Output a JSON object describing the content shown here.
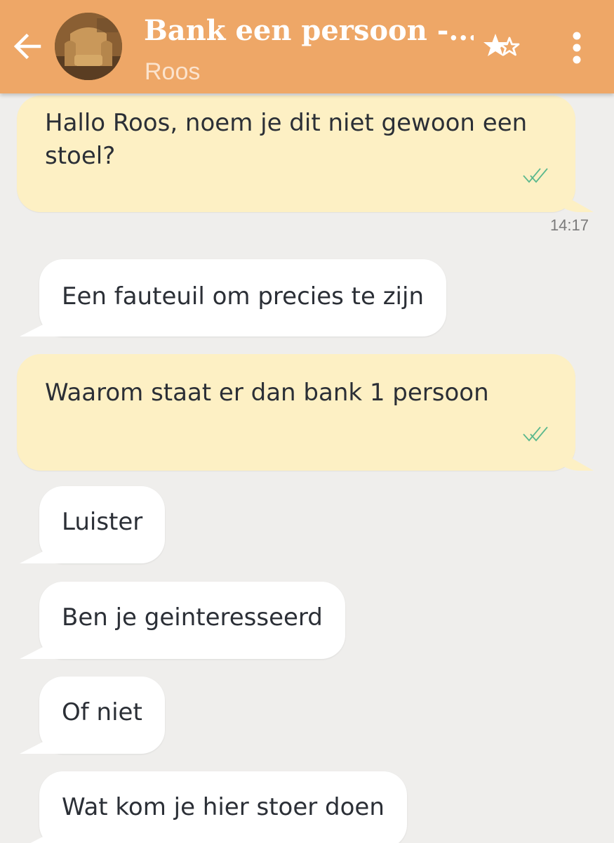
{
  "header": {
    "title": "Bank een persoon -...",
    "subtitle": "Roos",
    "back_icon": "arrow-left-icon",
    "favorite_icon": "star-add-icon",
    "more_icon": "more-vert-icon",
    "avatar_icon": "armchair-photo"
  },
  "colors": {
    "header": "#eea767",
    "background": "#efeeec",
    "outgoing_bubble": "#fdf0c4",
    "incoming_bubble": "#ffffff",
    "check": "#5bb88d"
  },
  "messages": [
    {
      "direction": "out",
      "text": "Hallo Roos,  noem je dit niet gewoon een stoel?",
      "status": "read",
      "time": "14:17"
    },
    {
      "direction": "in",
      "text": "Een fauteuil om precies te zijn"
    },
    {
      "direction": "out",
      "text": "Waarom staat er dan bank 1 persoon",
      "status": "read"
    },
    {
      "direction": "in",
      "text": "Luister"
    },
    {
      "direction": "in",
      "text": "Ben je geinteresseerd"
    },
    {
      "direction": "in",
      "text": "Of niet"
    },
    {
      "direction": "in",
      "text": "Wat kom je hier stoer doen"
    }
  ]
}
